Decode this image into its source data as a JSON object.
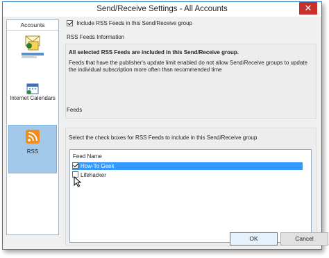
{
  "window": {
    "title": "Send/Receive Settings - All Accounts",
    "close_glyph": "✕"
  },
  "sidebar": {
    "header": "Accounts",
    "items": [
      {
        "label": "",
        "icon": "email-account-icon",
        "selected": false
      },
      {
        "label": "Internet Calendars",
        "icon": "internet-calendar-icon",
        "selected": false
      },
      {
        "label": "RSS",
        "icon": "rss-icon",
        "selected": true
      }
    ]
  },
  "include": {
    "label": "Include RSS Feeds in this Send/Receive group",
    "checked": true
  },
  "info": {
    "section": "RSS Feeds Information",
    "bold": "All selected RSS Feeds are included in this Send/Receive group.",
    "text": "Feeds that have the publisher's update limit enabled do not allow Send/Receive groups to update the individual subscription more often than recommended time"
  },
  "feeds": {
    "section": "Feeds",
    "instruction": "Select the check boxes for RSS Feeds to include in this Send/Receive group",
    "column": "Feed Name",
    "rows": [
      {
        "name": "How-To Geek",
        "checked": true,
        "selected": true
      },
      {
        "name": "Lifehacker",
        "checked": false,
        "selected": false
      }
    ]
  },
  "buttons": {
    "ok": "OK",
    "cancel": "Cancel"
  },
  "colors": {
    "accent": "#2b79c2",
    "selection": "#3399ff",
    "sidebar_selected": "#a3c9ea",
    "close": "#c7302b"
  }
}
